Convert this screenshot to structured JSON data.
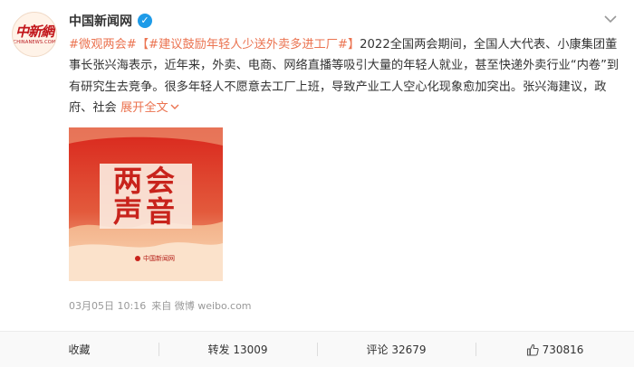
{
  "author": {
    "name": "中国新闻网",
    "avatar_logo_text": "中新網",
    "avatar_logo_sub": "CHINANEWS.COM"
  },
  "post": {
    "topic_1": "#微观两会#",
    "topic_2": "【#建议鼓励年轻人少送外卖多进工厂#】",
    "body": "2022全国两会期间，全国人大代表、小康集团董事长张兴海表示，近年来，外卖、电商、网络直播等吸引大量的年轻人就业，甚至快递外卖行业“内卷”到有研究生去竞争。很多年轻人不愿意去工厂上班，导致产业工人空心化现象愈加突出。张兴海建议，政府、社会",
    "expand_label": "展开全文"
  },
  "image": {
    "title_line_1": "两会",
    "title_line_2": "声音",
    "logo_text": "中国新闻网"
  },
  "meta": {
    "date": "03月05日 10:16",
    "source": "来自 微博 weibo.com"
  },
  "actions": {
    "favorite_label": "收藏",
    "repost_label": "转发 13009",
    "comment_label": "评论 32679",
    "like_label": "730816"
  },
  "colors": {
    "topic": "#eb7350",
    "verified": "#1e9be8",
    "poster_red": "#d3281f"
  },
  "icons": {
    "verified": "verified-badge-icon",
    "menu": "chevron-down-icon",
    "expand": "chevron-down-icon",
    "like": "thumbs-up-icon"
  }
}
